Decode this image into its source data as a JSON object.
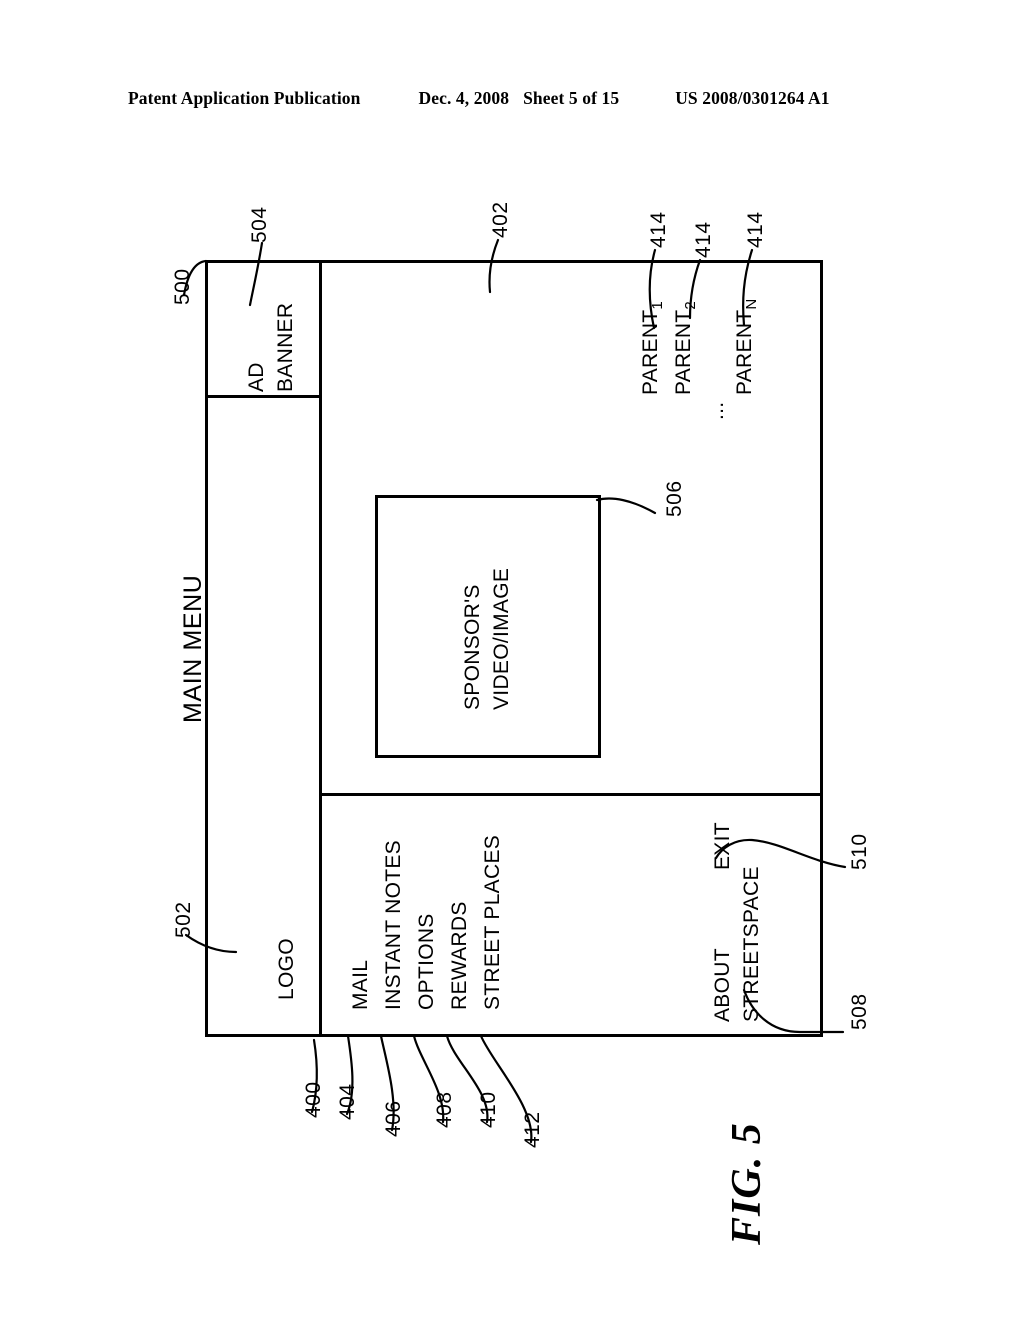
{
  "header": {
    "publication": "Patent Application Publication",
    "date": "Dec. 4, 2008",
    "sheet": "Sheet 5 of 15",
    "patent_number": "US 2008/0301264 A1"
  },
  "figure": {
    "label": "FIG. 5",
    "title": "MAIN MENU"
  },
  "ui": {
    "ad_banner": {
      "line1": "AD",
      "line2": "BANNER"
    },
    "logo": "LOGO",
    "sponsor": {
      "line1": "SPONSOR'S",
      "line2": "VIDEO/IMAGE"
    },
    "menu_items": [
      {
        "label": "MAIL",
        "ref": "404"
      },
      {
        "label": "INSTANT NOTES",
        "ref": "406"
      },
      {
        "label": "OPTIONS",
        "ref": "408"
      },
      {
        "label": "REWARDS",
        "ref": "410"
      },
      {
        "label": "STREET PLACES",
        "ref": "412"
      }
    ],
    "footer_items": [
      {
        "line1": "ABOUT",
        "line2": "STREETSPACE",
        "ref": "508"
      },
      {
        "line1": "EXIT",
        "line2": "",
        "ref": "510"
      }
    ],
    "parents": [
      {
        "name": "PARENT",
        "sub": "1",
        "ref": "414"
      },
      {
        "name": "PARENT",
        "sub": "2",
        "ref": "414"
      },
      {
        "name": "PARENT",
        "sub": "N",
        "ref": "414"
      }
    ],
    "parent_ellipsis": "..."
  },
  "reference_numerals": {
    "frame": "500",
    "menu_panel": "502",
    "ad_banner": "504",
    "content_area": "402",
    "sponsor_box": "506",
    "menu_bar": "400",
    "about": "508",
    "exit": "510"
  }
}
